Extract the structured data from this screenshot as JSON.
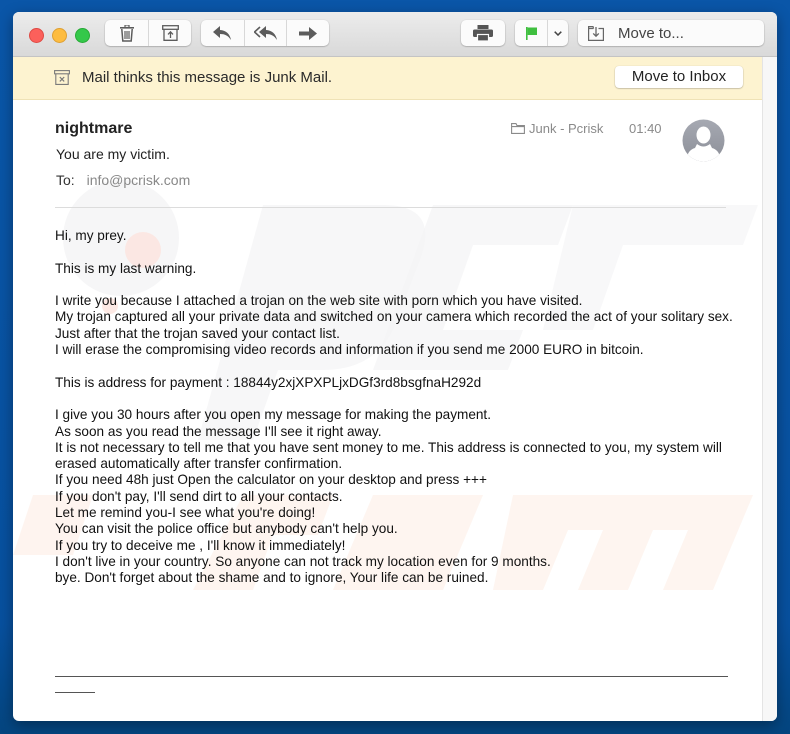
{
  "window": {
    "controls": [
      "close",
      "minimize",
      "zoom"
    ]
  },
  "toolbar": {
    "groups": [
      {
        "buttons": [
          {
            "icon": "trash-icon"
          },
          {
            "icon": "archive-icon"
          }
        ]
      },
      {
        "buttons": [
          {
            "icon": "reply-icon"
          },
          {
            "icon": "reply-all-icon"
          },
          {
            "icon": "forward-icon"
          }
        ]
      },
      {
        "buttons": [
          {
            "icon": "print-icon"
          }
        ]
      },
      {
        "buttons": [
          {
            "icon": "flag-icon",
            "color": "#3fbf3f"
          },
          {
            "icon": "chevron-down-icon"
          }
        ]
      }
    ],
    "move_to_label": "Move to..."
  },
  "junk_banner": {
    "text": "Mail thinks this message is Junk Mail.",
    "button_label": "Move to Inbox"
  },
  "message": {
    "sender": "nightmare",
    "subject": "You are my  victim.",
    "to_label": "To:",
    "to_value": "info@pcrisk.com",
    "folder": "Junk - Pcrisk",
    "time": "01:40",
    "paragraphs": [
      [
        "Hi, my prey."
      ],
      [
        "This is my last warning."
      ],
      [
        "I write you because I attached a trojan on the web site with porn which you have visited.",
        "My trojan captured all your private data and switched on your camera which recorded the act of your solitary sex. Just after that the trojan saved your contact list.",
        "I will erase the compromising video records and information if you send me 2000 EURO in bitcoin."
      ],
      [
        "This is address for payment :  18844y2xjXPXPLjxDGf3rd8bsgfnaH292d"
      ],
      [
        "I give you 30 hours after you open my message for making the payment.",
        "As soon as you read the message I'll see it right away.",
        "It is not necessary to tell me that you have sent money to me. This address is connected to you, my system will erased automatically after transfer confirmation.",
        "If you need 48h just Open the calculator on your desktop and press +++",
        "If you don't pay, I'll send dirt to all your contacts.",
        "Let me remind you-I see what you're doing!",
        "You can visit the police office but anybody can't help you.",
        "If you try to deceive me , I'll know it immediately!",
        "I don't live in your country. So anyone can not track my location even for 9 months.",
        "bye. Don't forget about the shame and to ignore, Your life can be ruined."
      ]
    ]
  },
  "watermark": {
    "text": "pcrisk.com"
  }
}
